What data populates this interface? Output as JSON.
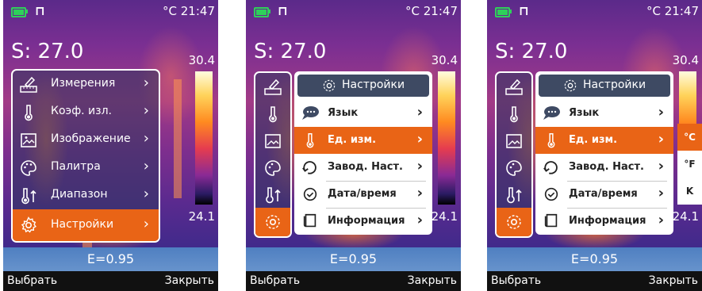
{
  "status": {
    "unit": "°C",
    "time": "21:47"
  },
  "reading": "S: 27.0",
  "scale": {
    "max": "30.4",
    "min": "24.1"
  },
  "emissivity": "E=0.95",
  "softkeys": {
    "left": "Выбрать",
    "right": "Закрыть"
  },
  "main_menu": [
    {
      "label": "Измерения",
      "icon": "measure-icon"
    },
    {
      "label": "Коэф. изл.",
      "icon": "thermometer-icon"
    },
    {
      "label": "Изображение",
      "icon": "image-icon"
    },
    {
      "label": "Палитра",
      "icon": "palette-icon"
    },
    {
      "label": "Диапазон",
      "icon": "range-icon"
    },
    {
      "label": "Настройки",
      "icon": "gear-icon",
      "selected": true
    }
  ],
  "settings_menu": {
    "title": "Настройки",
    "items": [
      {
        "label": "Язык",
        "icon": "speech-bubble-icon"
      },
      {
        "label": "Ед. изм.",
        "icon": "thermometer-icon",
        "selected": true
      },
      {
        "label": "Завод. Наст.",
        "icon": "reset-arrow-icon"
      },
      {
        "label": "Дата/время",
        "icon": "clock-icon"
      },
      {
        "label": "Информация",
        "icon": "document-icon"
      }
    ]
  },
  "unit_options": [
    {
      "label": "°C",
      "selected": true
    },
    {
      "label": "°F"
    },
    {
      "label": "K"
    }
  ],
  "colors": {
    "accent": "#e96416",
    "battery": "#2ed05a",
    "header": "#3e4a63"
  }
}
